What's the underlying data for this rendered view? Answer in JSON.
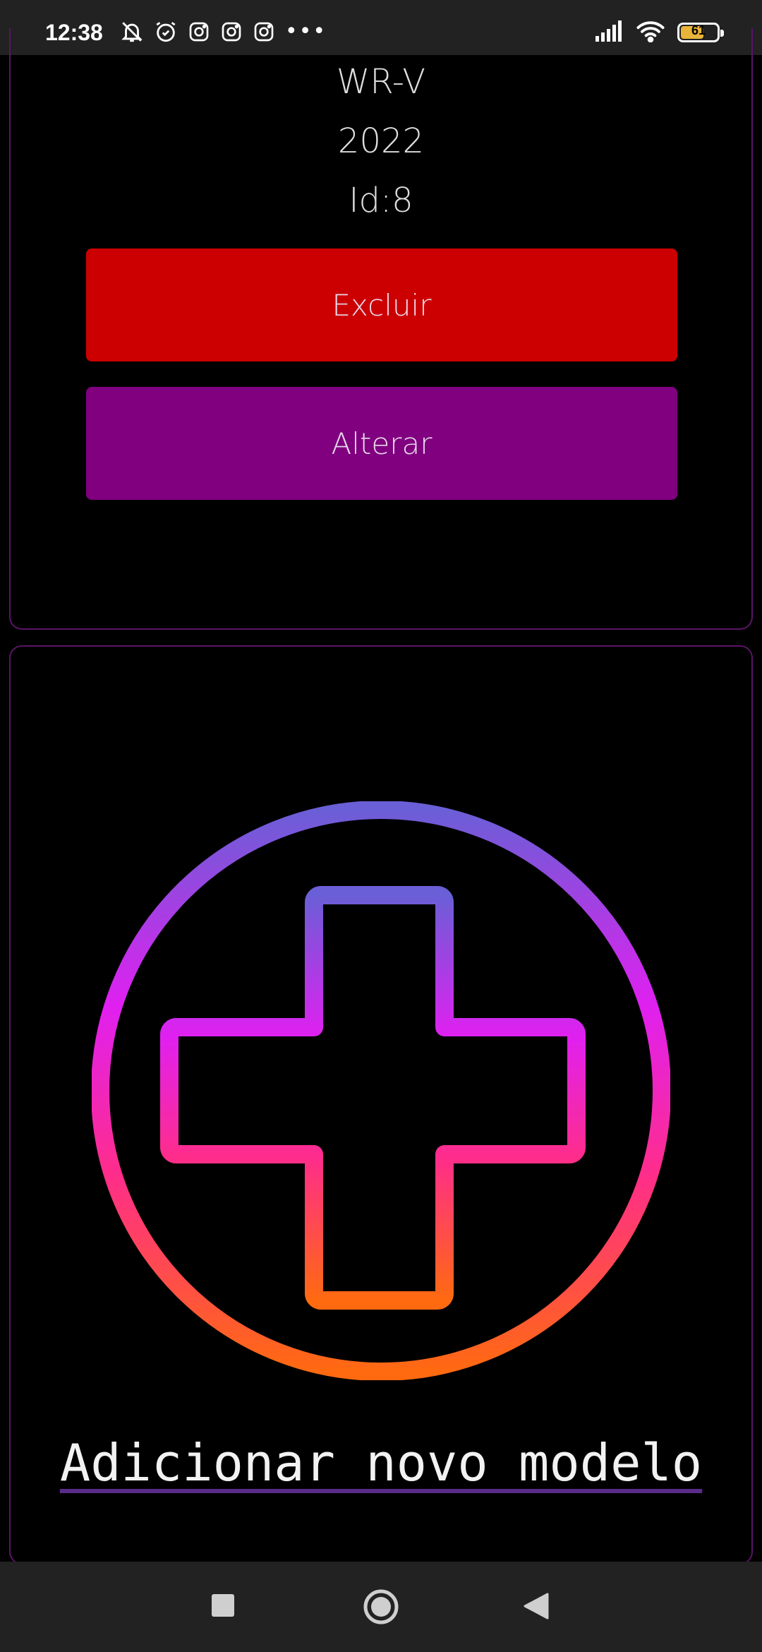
{
  "status_bar": {
    "time": "12:38",
    "left_icons": [
      "mute-bell-icon",
      "alarm-icon",
      "instagram-icon",
      "instagram-icon",
      "instagram-icon"
    ],
    "more_dots": "•••",
    "right_icons": [
      "signal-icon",
      "wifi-icon",
      "battery-icon"
    ],
    "battery_level": "61"
  },
  "car": {
    "model": "WR-V",
    "year": "2022",
    "id": "Id:8"
  },
  "buttons": {
    "delete_label": "Excluir",
    "edit_label": "Alterar",
    "delete_color": "#cc0000",
    "edit_color": "#800080"
  },
  "add": {
    "label": "Adicionar novo modelo",
    "icon": "add-circle-plus-icon",
    "gradient": [
      "#6a5fd6",
      "#e020f0",
      "#ff2d8a",
      "#ff6a10"
    ]
  },
  "nav_bar": {
    "icons": [
      "recents-square-icon",
      "home-circle-icon",
      "back-triangle-icon"
    ]
  }
}
